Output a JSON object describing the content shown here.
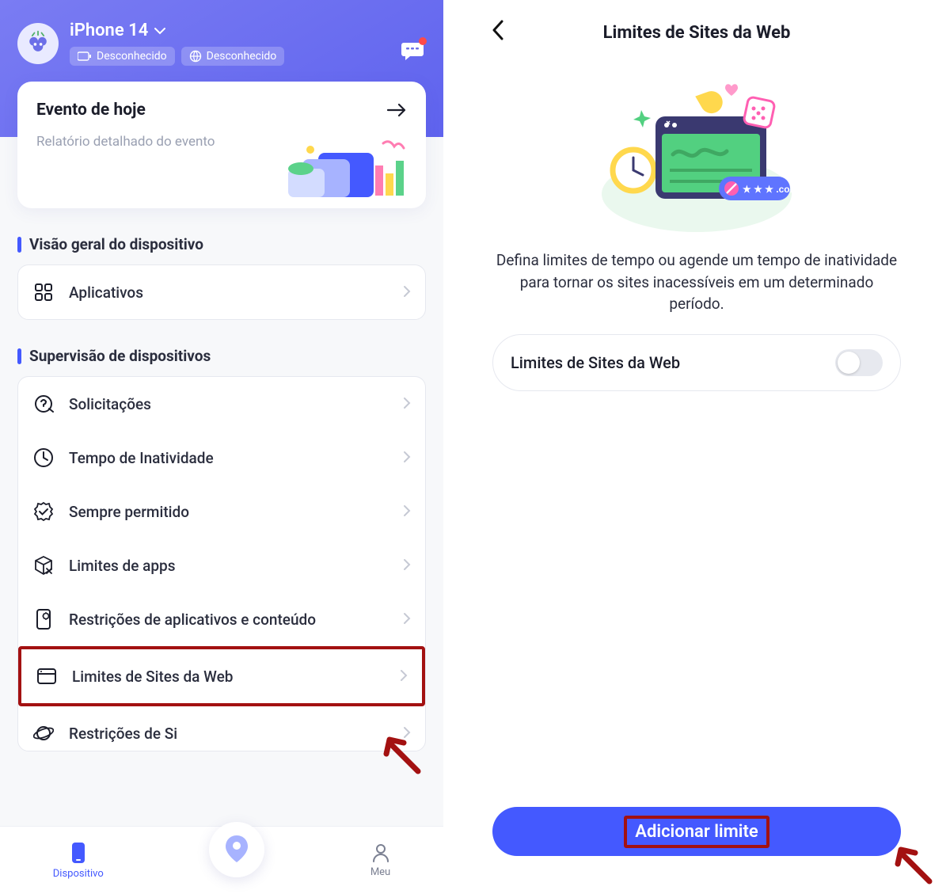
{
  "left": {
    "device_name": "iPhone 14",
    "tag1": "Desconhecido",
    "tag2": "Desconhecido",
    "event": {
      "title": "Evento de hoje",
      "subtitle": "Relatório detalhado do evento"
    },
    "section1": "Visão geral do dispositivo",
    "apps_label": "Aplicativos",
    "section2": "Supervisão de dispositivos",
    "items": [
      "Solicitações",
      "Tempo de Inatividade",
      "Sempre permitido",
      "Limites de apps",
      "Restrições de aplicativos e conteúdo",
      "Limites de Sites da Web",
      "Restrições de Si"
    ],
    "nav": {
      "device": "Dispositivo",
      "me": "Meu"
    }
  },
  "right": {
    "title": "Limites de Sites da Web",
    "description": "Defina limites de tempo ou agende um tempo de inatividade para tornar os sites inacessíveis em um determinado período.",
    "toggle_label": "Limites de Sites da Web",
    "button": "Adicionar limite"
  }
}
